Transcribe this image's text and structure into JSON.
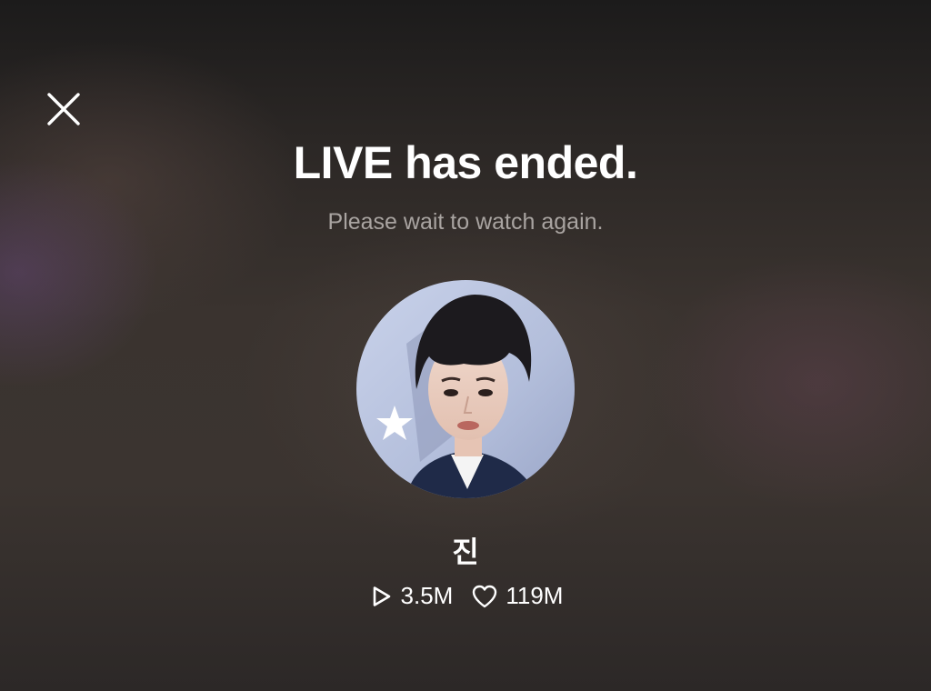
{
  "live_end": {
    "title": "LIVE has ended.",
    "subtitle": "Please wait to watch again."
  },
  "artist": {
    "name": "진",
    "avatar_description": "close-up portrait on light blue background with white star"
  },
  "stats": {
    "views": "3.5M",
    "likes": "119M"
  },
  "icons": {
    "close": "close-icon",
    "views": "play-icon",
    "likes": "heart-icon"
  }
}
